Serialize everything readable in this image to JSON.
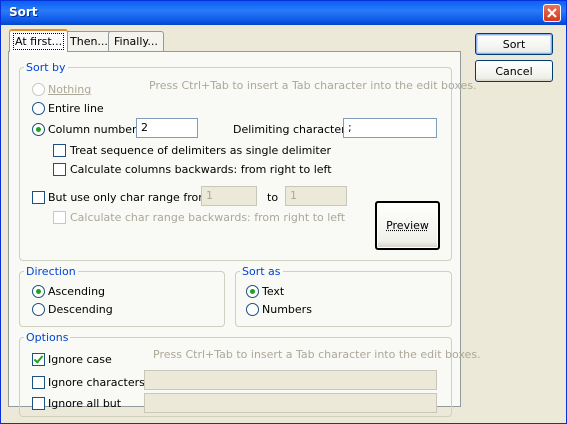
{
  "window": {
    "title": "Sort"
  },
  "tabs": [
    "At first...",
    "Then...",
    "Finally..."
  ],
  "sort_by": {
    "legend": "Sort by",
    "hint": "Press Ctrl+Tab to insert a Tab character into the edit boxes.",
    "nothing": "Nothing",
    "entire_line": "Entire line",
    "column_number": "Column number",
    "column_value": "2",
    "delimiting_label": "Delimiting characters",
    "delimiting_value": ";",
    "treat_sequence": "Treat sequence of delimiters as single delimiter",
    "calc_backwards": "Calculate columns backwards: from right to left",
    "char_range": "But use only char range from",
    "range_from": "1",
    "range_to_label": "to",
    "range_to": "1",
    "char_range_backwards": "Calculate char range backwards: from right to left",
    "preview": "Preview"
  },
  "direction": {
    "legend": "Direction",
    "ascending": "Ascending",
    "descending": "Descending"
  },
  "sort_as": {
    "legend": "Sort as",
    "text": "Text",
    "numbers": "Numbers"
  },
  "options": {
    "legend": "Options",
    "hint": "Press Ctrl+Tab to insert a Tab character into the edit boxes.",
    "ignore_case": "Ignore case",
    "ignore_characters": "Ignore characters",
    "ignore_all_but": "Ignore all but",
    "ignore_characters_value": "",
    "ignore_all_but_value": ""
  },
  "buttons": {
    "sort": "Sort",
    "cancel": "Cancel"
  }
}
